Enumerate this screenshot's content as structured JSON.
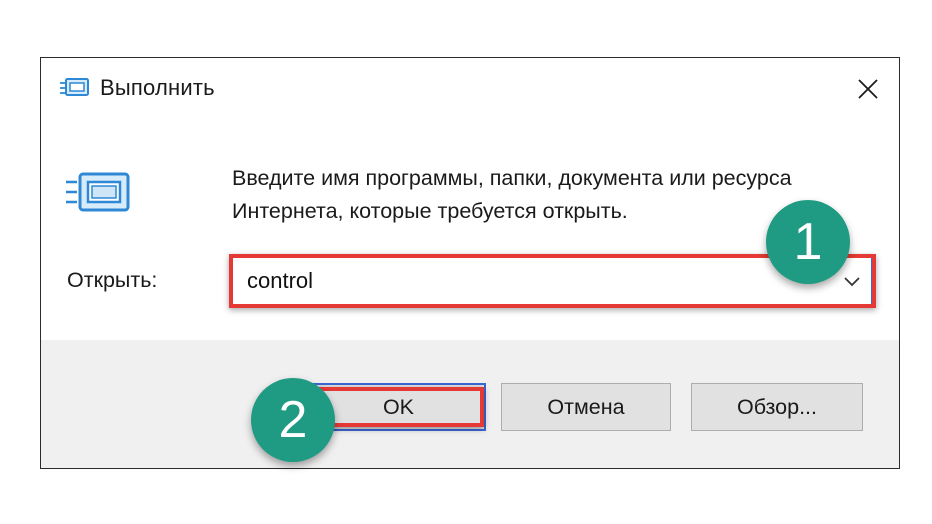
{
  "window": {
    "title": "Выполнить",
    "title_icon": "run-icon",
    "close_icon": "close-icon"
  },
  "dialog": {
    "big_icon": "run-icon",
    "instruction": "Введите имя программы, папки, документа или ресурса Интернета, которые требуется открыть.",
    "open_label": "Открыть:",
    "open_value": "control",
    "dropdown_icon": "chevron-down-icon"
  },
  "buttons": {
    "ok": "OK",
    "cancel": "Отмена",
    "browse": "Обзор..."
  },
  "annotations": {
    "step1": "1",
    "step2": "2",
    "badge_color": "#1f9b83",
    "highlight_color": "#e53935"
  }
}
